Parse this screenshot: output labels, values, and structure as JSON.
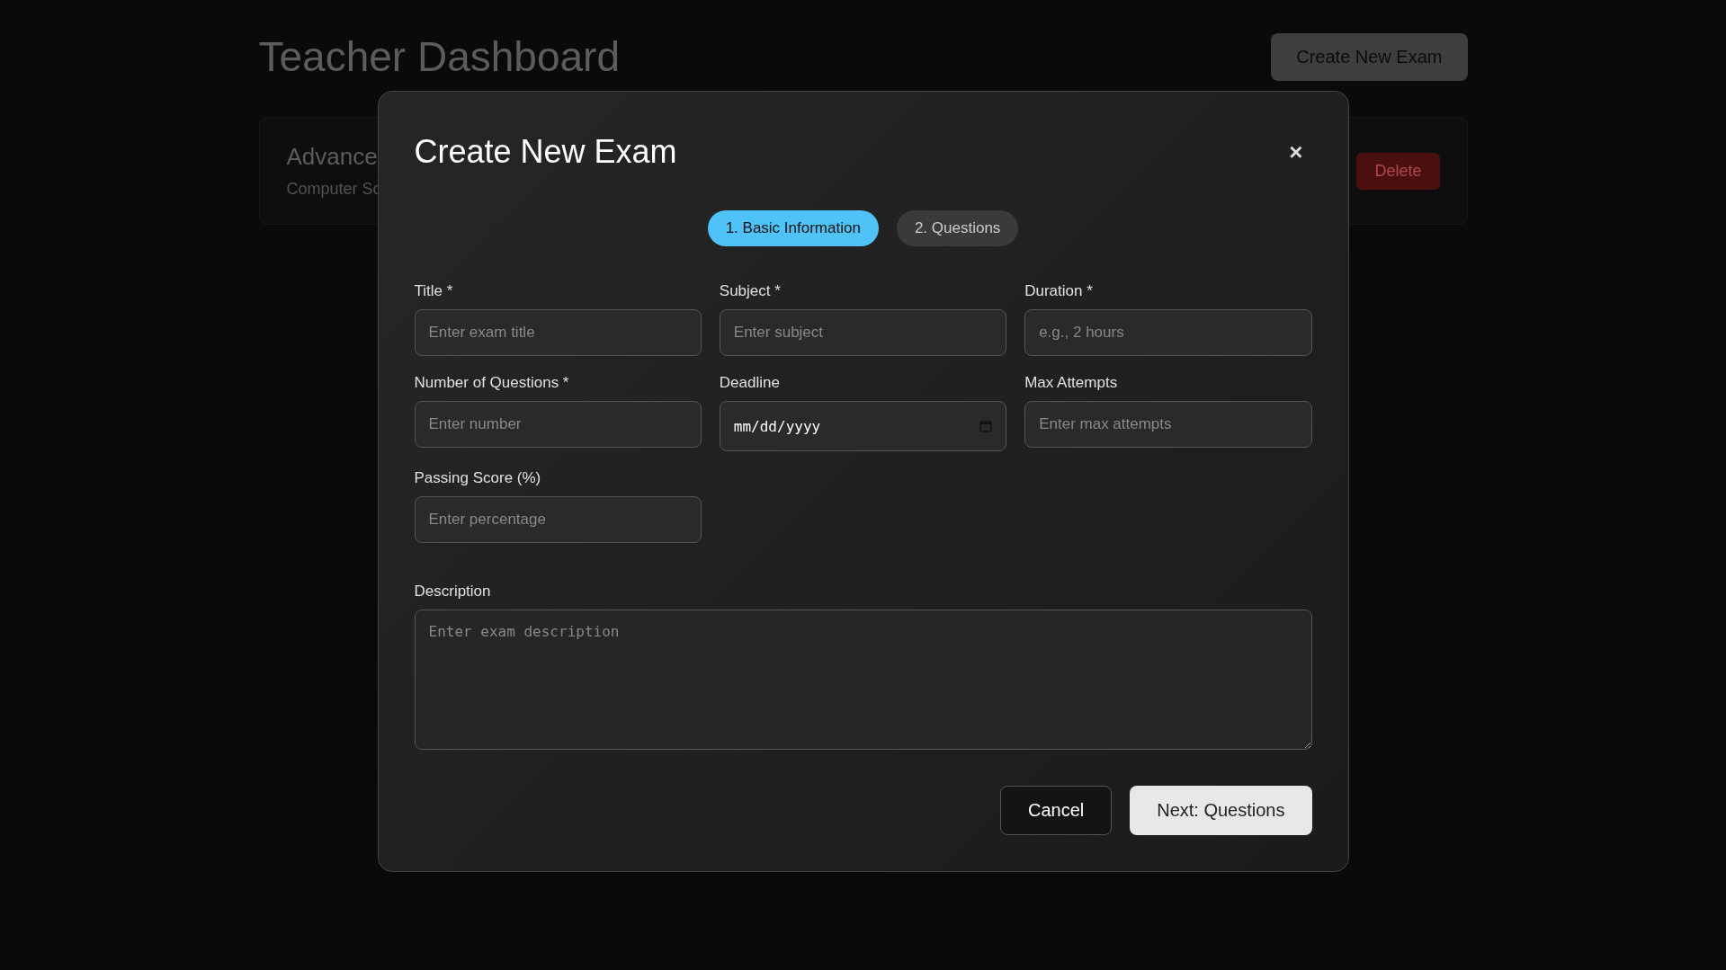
{
  "dashboard": {
    "title": "Teacher Dashboard",
    "create_button": "Create New Exam",
    "exam_card": {
      "title": "Advance",
      "subject": "Computer Sc",
      "delete_button": "Delete"
    }
  },
  "modal": {
    "title": "Create New Exam",
    "close": "×",
    "steps": [
      {
        "label": "1. Basic Information",
        "selected": true
      },
      {
        "label": "2. Questions",
        "selected": false
      }
    ],
    "fields": [
      {
        "kind": "text",
        "label": "Title *",
        "placeholder": "Enter exam title"
      },
      {
        "kind": "text",
        "label": "Subject *",
        "placeholder": "Enter subject"
      },
      {
        "kind": "text",
        "label": "Duration *",
        "placeholder": "e.g., 2 hours"
      },
      {
        "kind": "text",
        "label": "Number of Questions *",
        "placeholder": "Enter number"
      },
      {
        "kind": "date",
        "label": "Deadline",
        "value": "mm/dd/yyyy"
      },
      {
        "kind": "text",
        "label": "Max Attempts",
        "placeholder": "Enter max attempts"
      },
      {
        "kind": "text",
        "label": "Passing Score (%)",
        "placeholder": "Enter percentage"
      }
    ],
    "description": {
      "label": "Description",
      "placeholder": "Enter exam description"
    },
    "buttons": {
      "cancel": "Cancel",
      "next": "Next: Questions"
    }
  }
}
